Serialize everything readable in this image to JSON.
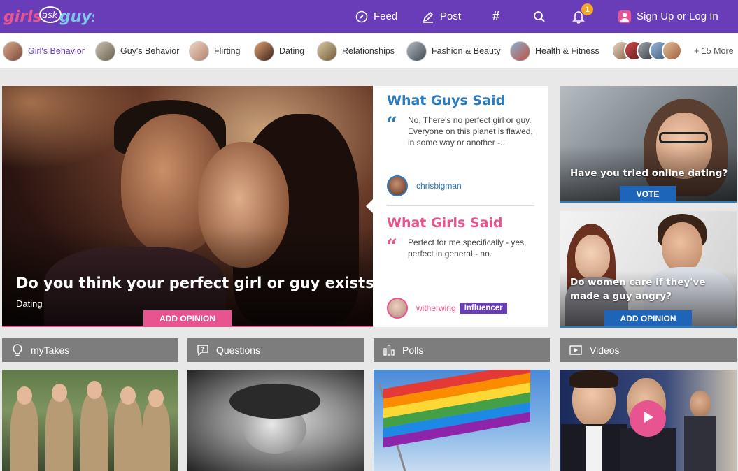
{
  "header": {
    "logo": "girls ask guys",
    "nav": {
      "feed": "Feed",
      "post": "Post",
      "hashtag": "#",
      "notif_count": "1",
      "signup": "Sign Up or Log In"
    },
    "icons": {
      "feed": "compass-icon",
      "post": "pencil-icon",
      "search": "search-icon",
      "notifications": "bell-icon",
      "user": "user-icon"
    }
  },
  "categories": {
    "items": [
      "Girl's Behavior",
      "Guy's Behavior",
      "Flirting",
      "Dating",
      "Relationships",
      "Fashion & Beauty",
      "Health & Fitness"
    ],
    "active": "Girl's Behavior",
    "more": "+ 15 More"
  },
  "featured": {
    "title": "Do you think your perfect girl or guy exists?",
    "category": "Dating",
    "button": "ADD OPINION"
  },
  "opinions": {
    "guys": {
      "heading": "What Guys Said",
      "text": "No, There's no perfect girl or guy. Everyone on this planet is flawed, in some way or another -...",
      "user": "chrisbigman"
    },
    "girls": {
      "heading": "What Girls Said",
      "text": "Perfect for me specifically - yes, perfect in general - no.",
      "user": "witherwing",
      "badge": "Influencer"
    }
  },
  "side": {
    "poll": {
      "title": "Have you tried online dating?",
      "button": "VOTE"
    },
    "take": {
      "title": "Do women care if they've made a guy angry?",
      "button": "ADD OPINION"
    }
  },
  "sections": {
    "mytakes": "myTakes",
    "questions": "Questions",
    "polls": "Polls",
    "videos": "Videos"
  },
  "colors": {
    "brand_purple": "#6a3db8",
    "accent_pink": "#e8548f",
    "accent_blue": "#2a7bbf",
    "button_blue": "#1e64b8",
    "badge_orange": "#f5a623"
  }
}
